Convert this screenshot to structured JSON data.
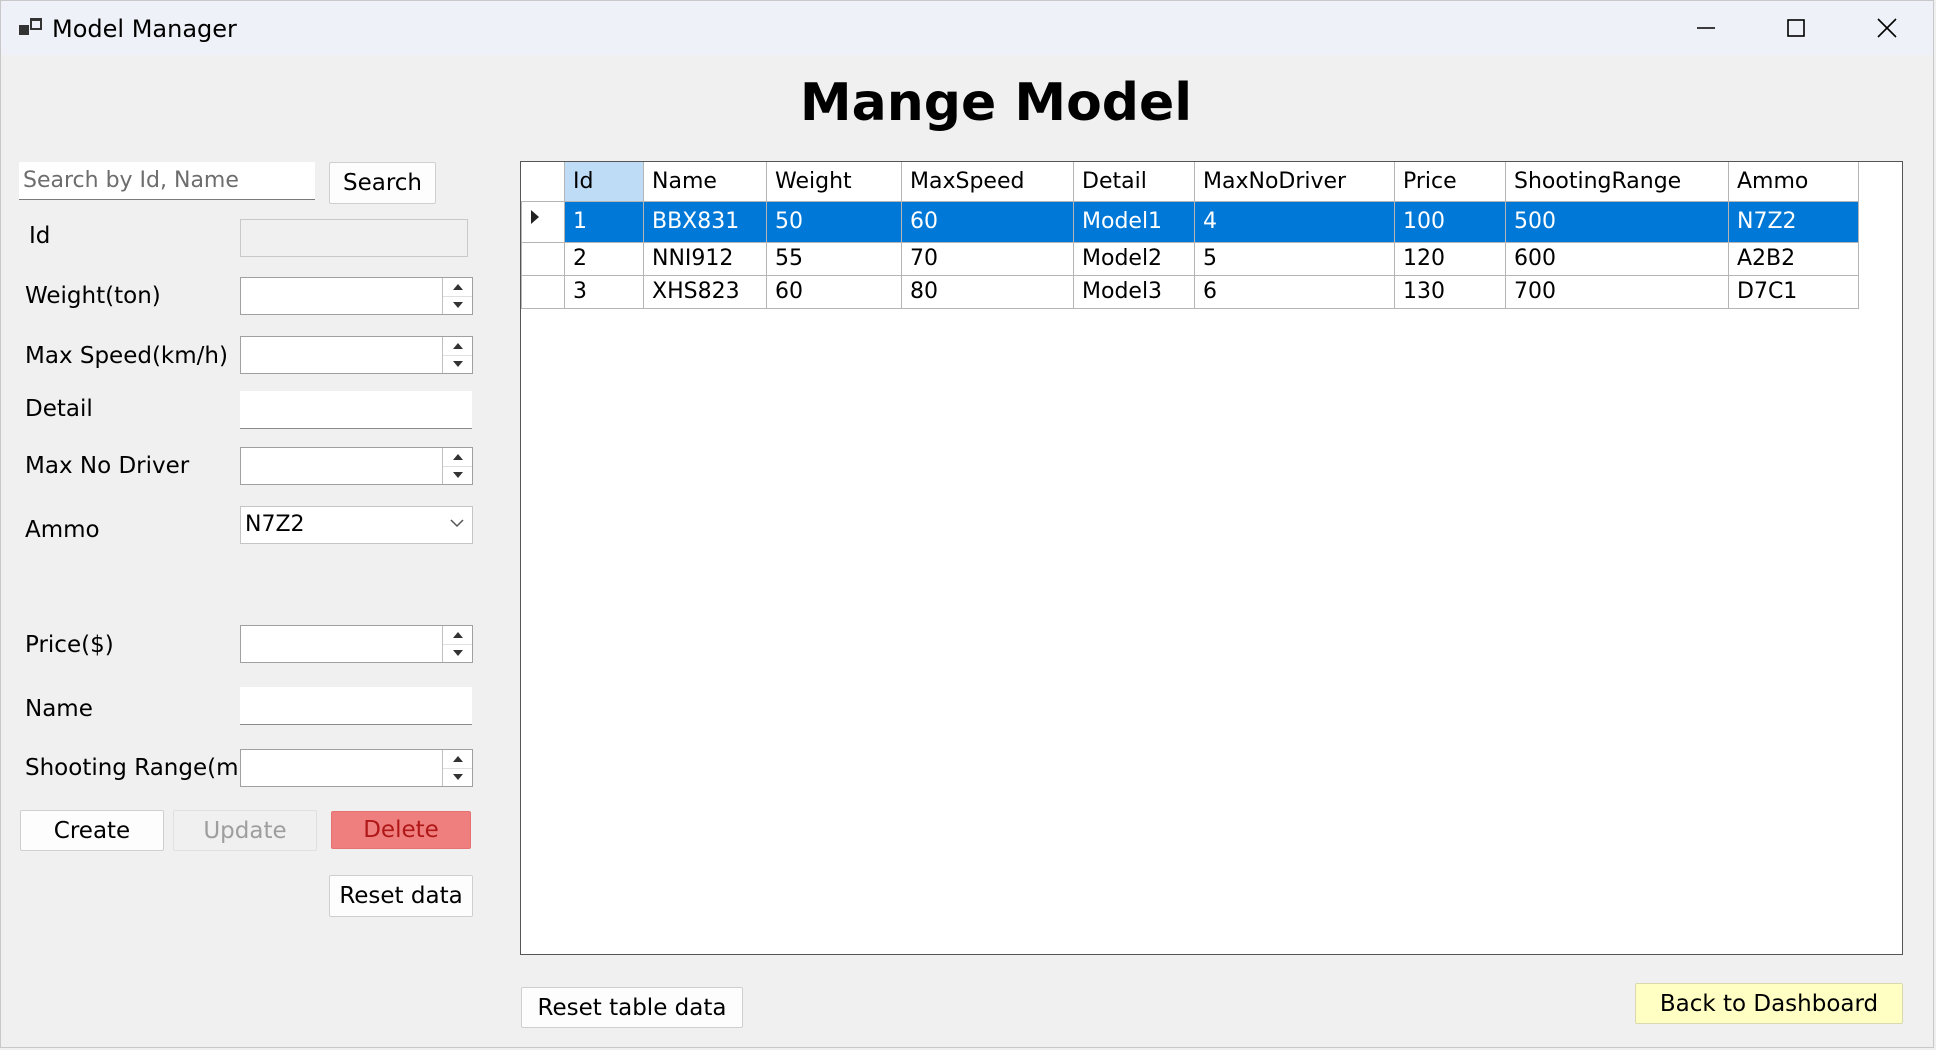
{
  "window": {
    "title": "Model Manager",
    "icon": "app-window-icon",
    "controls": [
      "minimize-icon",
      "maximize-icon",
      "close-icon"
    ]
  },
  "page": {
    "title": "Mange Model"
  },
  "search": {
    "placeholder": "Search by Id, Name",
    "value": "",
    "button_label": "Search"
  },
  "form": {
    "id_label": "Id",
    "id_value": "",
    "weight_label": "Weight(ton)",
    "max_speed_label": "Max Speed(km/h)",
    "detail_label": "Detail",
    "max_no_driver_label": "Max No Driver",
    "ammo_label": "Ammo",
    "ammo_value": "N7Z2",
    "price_label": "Price($)",
    "name_label": "Name",
    "shooting_range_label": "Shooting Range(m)"
  },
  "actions": {
    "create": "Create",
    "update": "Update",
    "delete": "Delete",
    "reset_data": "Reset data",
    "reset_table": "Reset table data",
    "back": "Back to Dashboard"
  },
  "colors": {
    "selection": "#0078d7",
    "sorted_header": "#bedcf5",
    "delete": "#ef7f7f",
    "back_button": "#ffffc4"
  },
  "grid": {
    "columns": [
      "Id",
      "Name",
      "Weight",
      "MaxSpeed",
      "Detail",
      "MaxNoDriver",
      "Price",
      "ShootingRange",
      "Ammo"
    ],
    "rows": [
      [
        "1",
        "BBX831",
        "50",
        "60",
        "Model1",
        "4",
        "100",
        "500",
        "N7Z2"
      ],
      [
        "2",
        "NNI912",
        "55",
        "70",
        "Model2",
        "5",
        "120",
        "600",
        "A2B2"
      ],
      [
        "3",
        "XHS823",
        "60",
        "80",
        "Model3",
        "6",
        "130",
        "700",
        "D7C1"
      ]
    ],
    "selected_row": 0
  }
}
